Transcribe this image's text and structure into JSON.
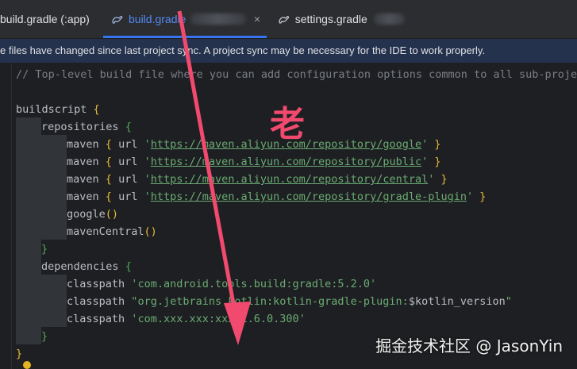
{
  "tabs": [
    {
      "label": "build.gradle (:app)",
      "active": false
    },
    {
      "label": "build.gradle",
      "active": true,
      "close": "×"
    },
    {
      "label": "settings.gradle",
      "active": false
    }
  ],
  "banner": {
    "text": "e files have changed since last project sync. A project sync may be necessary for the IDE to work properly."
  },
  "code": {
    "comment": "// Top-level build file where you can add configuration options common to all sub-projects",
    "buildscript": "buildscript",
    "repositories": "repositories",
    "maven": "maven",
    "url_kw": "url",
    "repos": [
      "https://maven.aliyun.com/repository/google",
      "https://maven.aliyun.com/repository/public",
      "https://maven.aliyun.com/repository/central",
      "https://maven.aliyun.com/repository/gradle-plugin"
    ],
    "google": "google",
    "mavenCentral": "mavenCentral",
    "dependencies": "dependencies",
    "classpath": "classpath",
    "cp1": "com.android.tools.build:gradle:5.2.0",
    "cp2_prefix": "org.jetbrains.kotlin:kotlin-gradle-plugin:",
    "cp2_var": "$kotlin_version",
    "cp3": "com.xxx.xxx:xxx:1.6.0.300",
    "open_brace": "{",
    "close_brace": "}",
    "parens": "()"
  },
  "overlay": {
    "char": "老",
    "watermark": "掘金技术社区 @ JasonYin",
    "arrow_color": "#f24a6f"
  },
  "colors": {
    "accent": "#3574f0",
    "string": "#6aab73",
    "comment": "#7a7e85"
  }
}
